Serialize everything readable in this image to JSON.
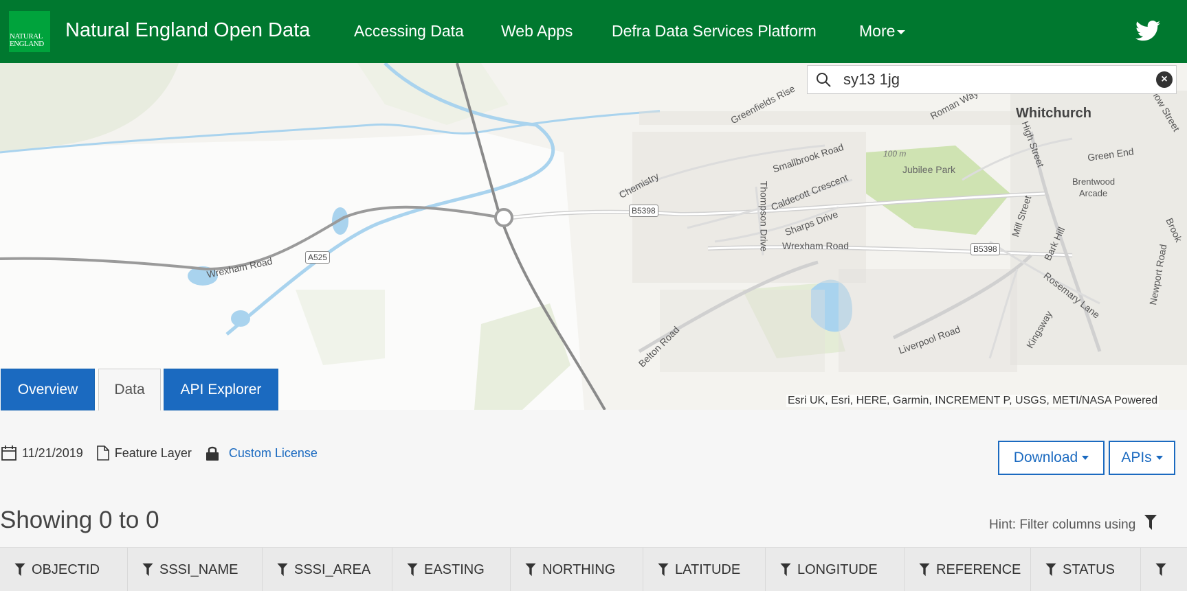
{
  "header": {
    "logo_line1": "NATURAL",
    "logo_line2": "ENGLAND",
    "title": "Natural England Open Data",
    "nav": [
      "Accessing Data",
      "Web Apps",
      "Defra Data Services Platform",
      "More"
    ]
  },
  "search": {
    "value": "sy13 1jg"
  },
  "map": {
    "labels": {
      "whitchurch": "Whitchurch",
      "greenfields": "Greenfields Rise",
      "roman_way": "Roman Way",
      "smallbrook": "Smallbrook Road",
      "caldecott": "Caldecott Crescent",
      "sharps": "Sharps Drive",
      "thompson": "Thompson Drive",
      "wrexham_east": "Wrexham Road",
      "wrexham_west": "Wrexham Road",
      "chemistry": "Chemistry",
      "jubilee": "Jubilee Park",
      "contour": "100 m",
      "high_street": "High Street",
      "green_end": "Green End",
      "brentwood": "Brentwood",
      "arcade": "Arcade",
      "mill_street": "Mill Street",
      "bark_hill": "Bark Hill",
      "rosemary": "Rosemary Lane",
      "newport": "Newport Road",
      "kingsway": "Kingsway",
      "liverpool": "Liverpool Road",
      "belton": "Belton Road",
      "brook": "Brook",
      "snowlow": "Snowlow Street",
      "a525": "A525",
      "b5398a": "B5398",
      "b5398b": "B5398"
    },
    "attribution": "Esri UK, Esri, HERE, Garmin, INCREMENT P, USGS, METI/NASA   Powered"
  },
  "tabs": [
    "Overview",
    "Data",
    "API Explorer"
  ],
  "meta": {
    "date": "11/21/2019",
    "type": "Feature Layer",
    "license": "Custom License"
  },
  "buttons": {
    "download": "Download",
    "apis": "APIs"
  },
  "showing": "Showing 0 to 0",
  "hint": "Hint: Filter columns using",
  "columns": [
    "OBJECTID",
    "SSSI_NAME",
    "SSSI_AREA",
    "EASTING",
    "NORTHING",
    "LATITUDE",
    "LONGITUDE",
    "REFERENCE",
    "STATUS"
  ],
  "colors": {
    "header": "#00782f",
    "accent": "#1b6ac0"
  }
}
